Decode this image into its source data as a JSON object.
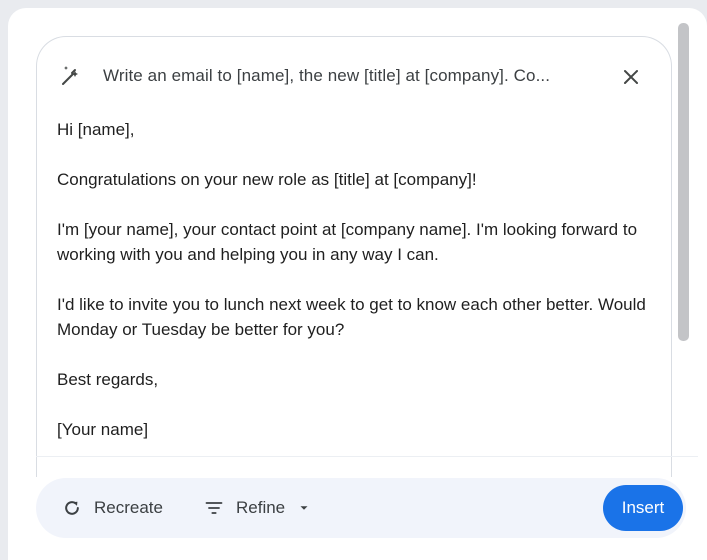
{
  "prompt": {
    "icon": "magic-pen-icon",
    "text": "Write an email to [name], the new [title] at [company]. Co...",
    "close_icon": "close-icon"
  },
  "draft": {
    "greeting": "Hi [name],",
    "paragraph_1": "Congratulations on your new role as [title] at [company]!",
    "paragraph_2": "I'm [your name], your contact point at [company name]. I'm looking forward to working with you and helping you in any way I can.",
    "paragraph_3": "I'd like to invite you to lunch next week to get to know each other better. Would Monday or Tuesday be better for you?",
    "closing": "Best regards,",
    "signature": "[Your name]"
  },
  "toolbar": {
    "recreate_label": "Recreate",
    "recreate_icon": "refresh-icon",
    "refine_label": "Refine",
    "refine_icon": "filter-lines-icon",
    "refine_dropdown_icon": "caret-down-icon",
    "insert_label": "Insert"
  },
  "colors": {
    "accent": "#1a73e8",
    "toolbar_bg": "#f1f4fb",
    "text": "#1f1f1f"
  }
}
